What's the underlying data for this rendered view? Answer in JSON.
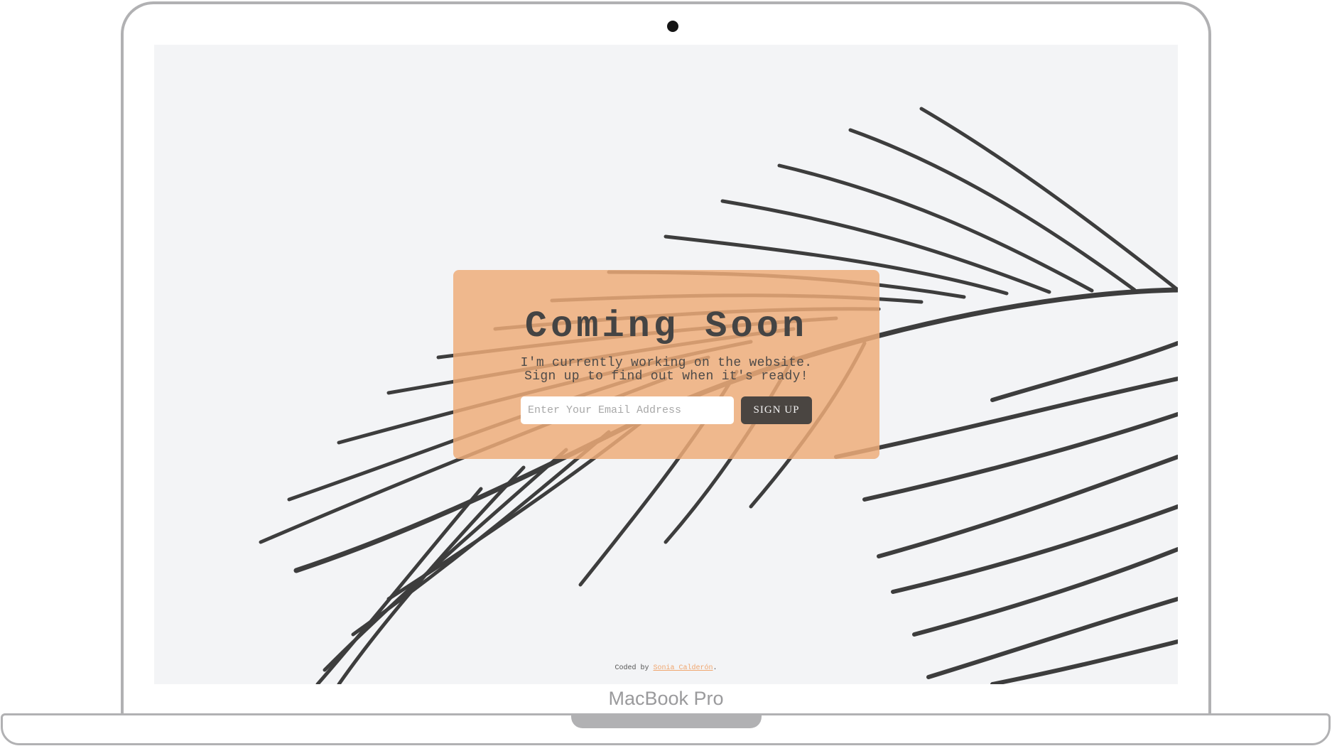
{
  "device": {
    "label": "MacBook Pro"
  },
  "hero": {
    "title": "Coming Soon",
    "subtitle_line1": "I'm currently working on the website.",
    "subtitle_line2": "Sign up to find out when it's ready!"
  },
  "signup": {
    "email_placeholder": "Enter Your Email Address",
    "email_value": "",
    "button_label": "SIGN UP"
  },
  "footer": {
    "prefix": "Coded by ",
    "author": "Sonia Calderón",
    "suffix": "."
  },
  "colors": {
    "accent": "#eeac78",
    "button": "#4a4541",
    "background": "#f3f4f6",
    "foliage": "#3c3c3c"
  },
  "icons": {
    "background_image": "palm-leaf-illustration"
  }
}
